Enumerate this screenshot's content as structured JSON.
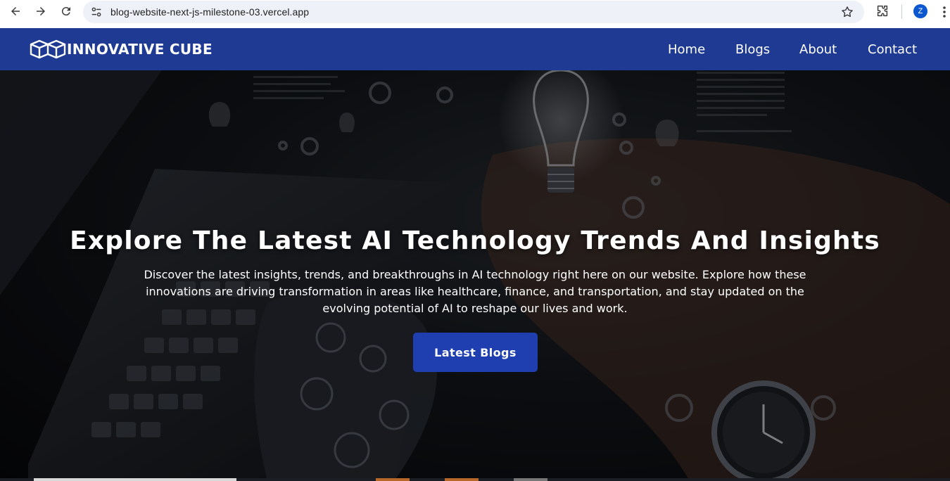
{
  "browser": {
    "url": "blog-website-next-js-milestone-03.vercel.app",
    "profile_initial": "Z"
  },
  "site": {
    "brand": "INNOVATIVE CUBE",
    "nav": [
      {
        "label": "Home"
      },
      {
        "label": "Blogs"
      },
      {
        "label": "About"
      },
      {
        "label": "Contact"
      }
    ],
    "colors": {
      "navbar": "#1f3a93",
      "cta": "#1f3fb0"
    }
  },
  "hero": {
    "title": "Explore The Latest AI Technology Trends And Insights",
    "description": "Discover the latest insights, trends, and breakthroughs in AI technology right here on our website. Explore how these innovations are driving transformation in areas like healthcare, finance, and transportation, and stay updated on the evolving potential of AI to reshape our lives and work.",
    "cta_label": "Latest Blogs"
  }
}
